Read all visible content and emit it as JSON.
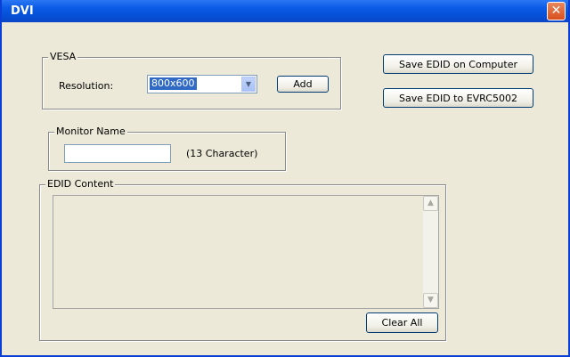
{
  "window": {
    "title": "DVI",
    "close_glyph": "✕"
  },
  "vesa": {
    "legend": "VESA",
    "resolution_label": "Resolution:",
    "resolution_value": "800x600",
    "add_label": "Add"
  },
  "actions": {
    "save_computer_label": "Save EDID on Computer",
    "save_device_label": "Save EDID to EVRC5002"
  },
  "monitor": {
    "legend": "Monitor Name",
    "name_value": "",
    "hint": "(13 Character)"
  },
  "edid": {
    "legend": "EDID Content",
    "content": "",
    "clear_label": "Clear All",
    "scroll_up_glyph": "▲",
    "scroll_down_glyph": "▼"
  },
  "colors": {
    "titlebar": "#0550d6",
    "window_bg": "#ece9d8",
    "selection": "#316ac5",
    "close_button": "#d94f1c"
  },
  "icons": [
    "close-icon",
    "dropdown-arrow-icon",
    "scroll-up-icon",
    "scroll-down-icon"
  ]
}
